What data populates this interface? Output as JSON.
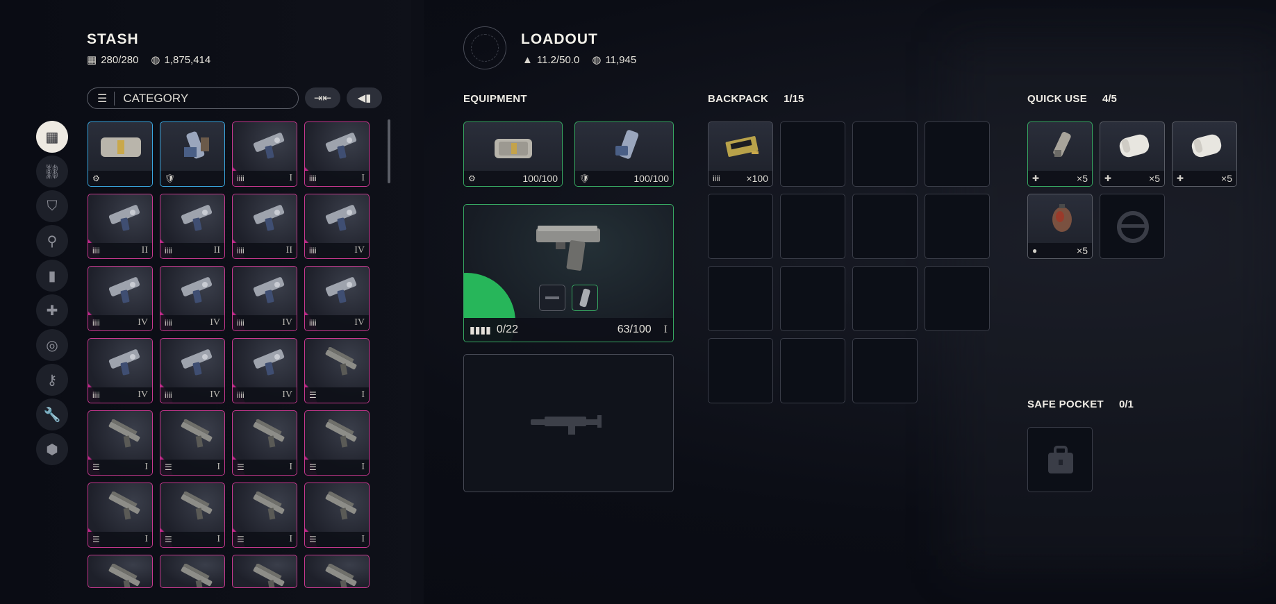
{
  "stash": {
    "title": "STASH",
    "capacity": "280/280",
    "credits": "1,875,414",
    "filter_label": "CATEGORY",
    "categories": [
      "all-grid-icon",
      "chain-icon",
      "shield-icon",
      "weapon-icon",
      "ammo-icon",
      "attachment-icon",
      "safe-icon",
      "key-icon",
      "wrench-icon",
      "cube-icon"
    ],
    "items": [
      {
        "rarity": "blue",
        "kind": "armor",
        "icon": "⚙",
        "tier": ""
      },
      {
        "rarity": "blue",
        "kind": "shield",
        "icon": "🛡",
        "tier": ""
      },
      {
        "rarity": "rare",
        "kind": "pistol",
        "icon": "iiii",
        "tier": "I"
      },
      {
        "rarity": "rare",
        "kind": "pistol",
        "icon": "iiii",
        "tier": "I"
      },
      {
        "rarity": "rare",
        "kind": "pistol",
        "icon": "iiii",
        "tier": "II"
      },
      {
        "rarity": "rare",
        "kind": "pistol",
        "icon": "iiii",
        "tier": "II"
      },
      {
        "rarity": "rare",
        "kind": "pistol",
        "icon": "iiii",
        "tier": "II"
      },
      {
        "rarity": "rare",
        "kind": "pistol",
        "icon": "iiii",
        "tier": "IV"
      },
      {
        "rarity": "rare",
        "kind": "pistol",
        "icon": "iiii",
        "tier": "IV"
      },
      {
        "rarity": "rare",
        "kind": "pistol",
        "icon": "iiii",
        "tier": "IV"
      },
      {
        "rarity": "rare",
        "kind": "pistol",
        "icon": "iiii",
        "tier": "IV"
      },
      {
        "rarity": "rare",
        "kind": "pistol",
        "icon": "iiii",
        "tier": "IV"
      },
      {
        "rarity": "rare",
        "kind": "pistol",
        "icon": "iiii",
        "tier": "IV"
      },
      {
        "rarity": "rare",
        "kind": "pistol",
        "icon": "iiii",
        "tier": "IV"
      },
      {
        "rarity": "rare",
        "kind": "pistol",
        "icon": "iiii",
        "tier": "IV"
      },
      {
        "rarity": "rare",
        "kind": "rifle",
        "icon": "☰",
        "tier": "I"
      },
      {
        "rarity": "rare",
        "kind": "rifle",
        "icon": "☰",
        "tier": "I"
      },
      {
        "rarity": "rare",
        "kind": "rifle",
        "icon": "☰",
        "tier": "I"
      },
      {
        "rarity": "rare",
        "kind": "rifle",
        "icon": "☰",
        "tier": "I"
      },
      {
        "rarity": "rare",
        "kind": "rifle",
        "icon": "☰",
        "tier": "I"
      },
      {
        "rarity": "rare",
        "kind": "rifle",
        "icon": "☰",
        "tier": "I"
      },
      {
        "rarity": "rare",
        "kind": "rifle",
        "icon": "☰",
        "tier": "I"
      },
      {
        "rarity": "rare",
        "kind": "rifle",
        "icon": "☰",
        "tier": "I"
      },
      {
        "rarity": "rare",
        "kind": "rifle",
        "icon": "☰",
        "tier": "I"
      }
    ]
  },
  "loadout": {
    "title": "LOADOUT",
    "weight": "11.2/50.0",
    "credits": "11,945",
    "equipment_label": "EQUIPMENT",
    "augment_durability": "100/100",
    "shield_durability": "100/100",
    "weapon_ammo": "0/22",
    "weapon_durability": "63/100",
    "weapon_tier": "I"
  },
  "backpack": {
    "label": "BACKPACK",
    "count": "1/15",
    "ammo_qty": "×100"
  },
  "quick_use": {
    "label": "QUICK USE",
    "count": "4/5",
    "items": [
      {
        "rarity": "green",
        "qty": "×5"
      },
      {
        "rarity": "grey",
        "qty": "×5"
      },
      {
        "rarity": "grey",
        "qty": "×5"
      },
      {
        "rarity": "grey",
        "qty": "×5"
      }
    ]
  },
  "safe_pocket": {
    "label": "SAFE POCKET",
    "count": "0/1"
  },
  "colors": {
    "rare": "#c8388f",
    "uncommon": "#2fc266",
    "common_blue": "#19a4f0",
    "background": "#0b0d15"
  }
}
